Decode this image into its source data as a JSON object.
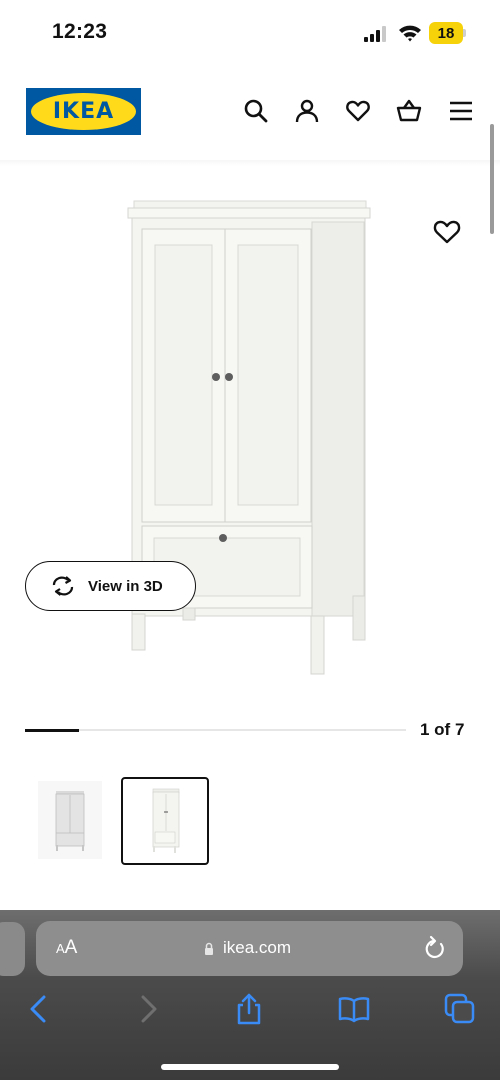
{
  "status_bar": {
    "time": "12:23",
    "battery": "18"
  },
  "header": {
    "logo_text": "IKEA",
    "icons": [
      "search-icon",
      "account-icon",
      "favourites-icon",
      "cart-icon",
      "menu-icon"
    ]
  },
  "product": {
    "view_3d_label": "View in 3D",
    "favourite_icon": "heart-icon"
  },
  "gallery": {
    "current": 1,
    "total": 7,
    "counter_text": "1 of 7",
    "progress_fraction": 0.143,
    "thumbnails": [
      {
        "name": "thumbnail-1",
        "selected": false
      },
      {
        "name": "thumbnail-2",
        "selected": true
      }
    ]
  },
  "browser": {
    "text_size_label": "AA",
    "url": "ikea.com",
    "toolbar_icons": [
      "back-icon",
      "forward-icon",
      "share-icon",
      "bookmarks-icon",
      "tabs-icon"
    ]
  },
  "colors": {
    "ikea_blue": "#0058a3",
    "ikea_yellow": "#ffda1a",
    "browser_accent": "#3a8bf5"
  }
}
